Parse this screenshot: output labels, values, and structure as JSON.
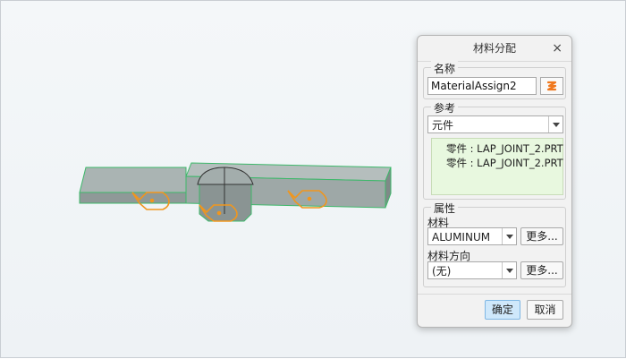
{
  "dialog": {
    "title": "材料分配",
    "close_label": "×",
    "name_group": {
      "legend": "名称",
      "value": "MaterialAssign2",
      "action_icon": "orange-action-icon"
    },
    "reference_group": {
      "legend": "参考",
      "type_value": "元件",
      "items": [
        "零件 : LAP_JOINT_2.PRT",
        "零件 : LAP_JOINT_2.PRT"
      ]
    },
    "properties_group": {
      "legend": "属性",
      "material_label": "材料",
      "material_value": "ALUMINUM",
      "material_more": "更多...",
      "orientation_label": "材料方向",
      "orientation_value": "(无)",
      "orientation_more": "更多..."
    },
    "ok_label": "确定",
    "cancel_label": "取消"
  },
  "colors": {
    "part_face": "#a9b3b2",
    "part_edge": "#3db86a",
    "annotation": "#f0961e",
    "ok_button": "#cfe8fb"
  }
}
